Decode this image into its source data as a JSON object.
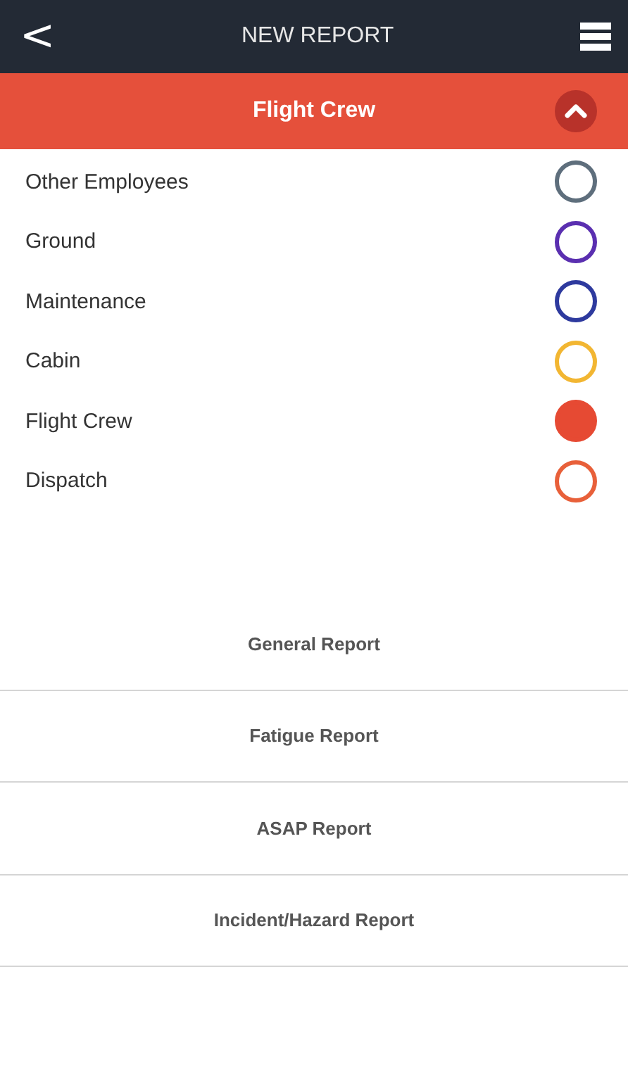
{
  "header": {
    "back": "<",
    "title": "NEW REPORT"
  },
  "section": {
    "title": "Flight Crew",
    "expanded": true
  },
  "categories": [
    {
      "label": "Other Employees",
      "color": "#5e6e7c",
      "selected": false
    },
    {
      "label": "Ground",
      "color": "#5a2fb0",
      "selected": false
    },
    {
      "label": "Maintenance",
      "color": "#2e3a9e",
      "selected": false
    },
    {
      "label": "Cabin",
      "color": "#f2b632",
      "selected": false
    },
    {
      "label": "Flight Crew",
      "color": "#e64a33",
      "selected": true
    },
    {
      "label": "Dispatch",
      "color": "#e8603a",
      "selected": false
    }
  ],
  "reports": [
    "General Report",
    "Fatigue  Report",
    "ASAP Report",
    "Incident/Hazard Report"
  ]
}
